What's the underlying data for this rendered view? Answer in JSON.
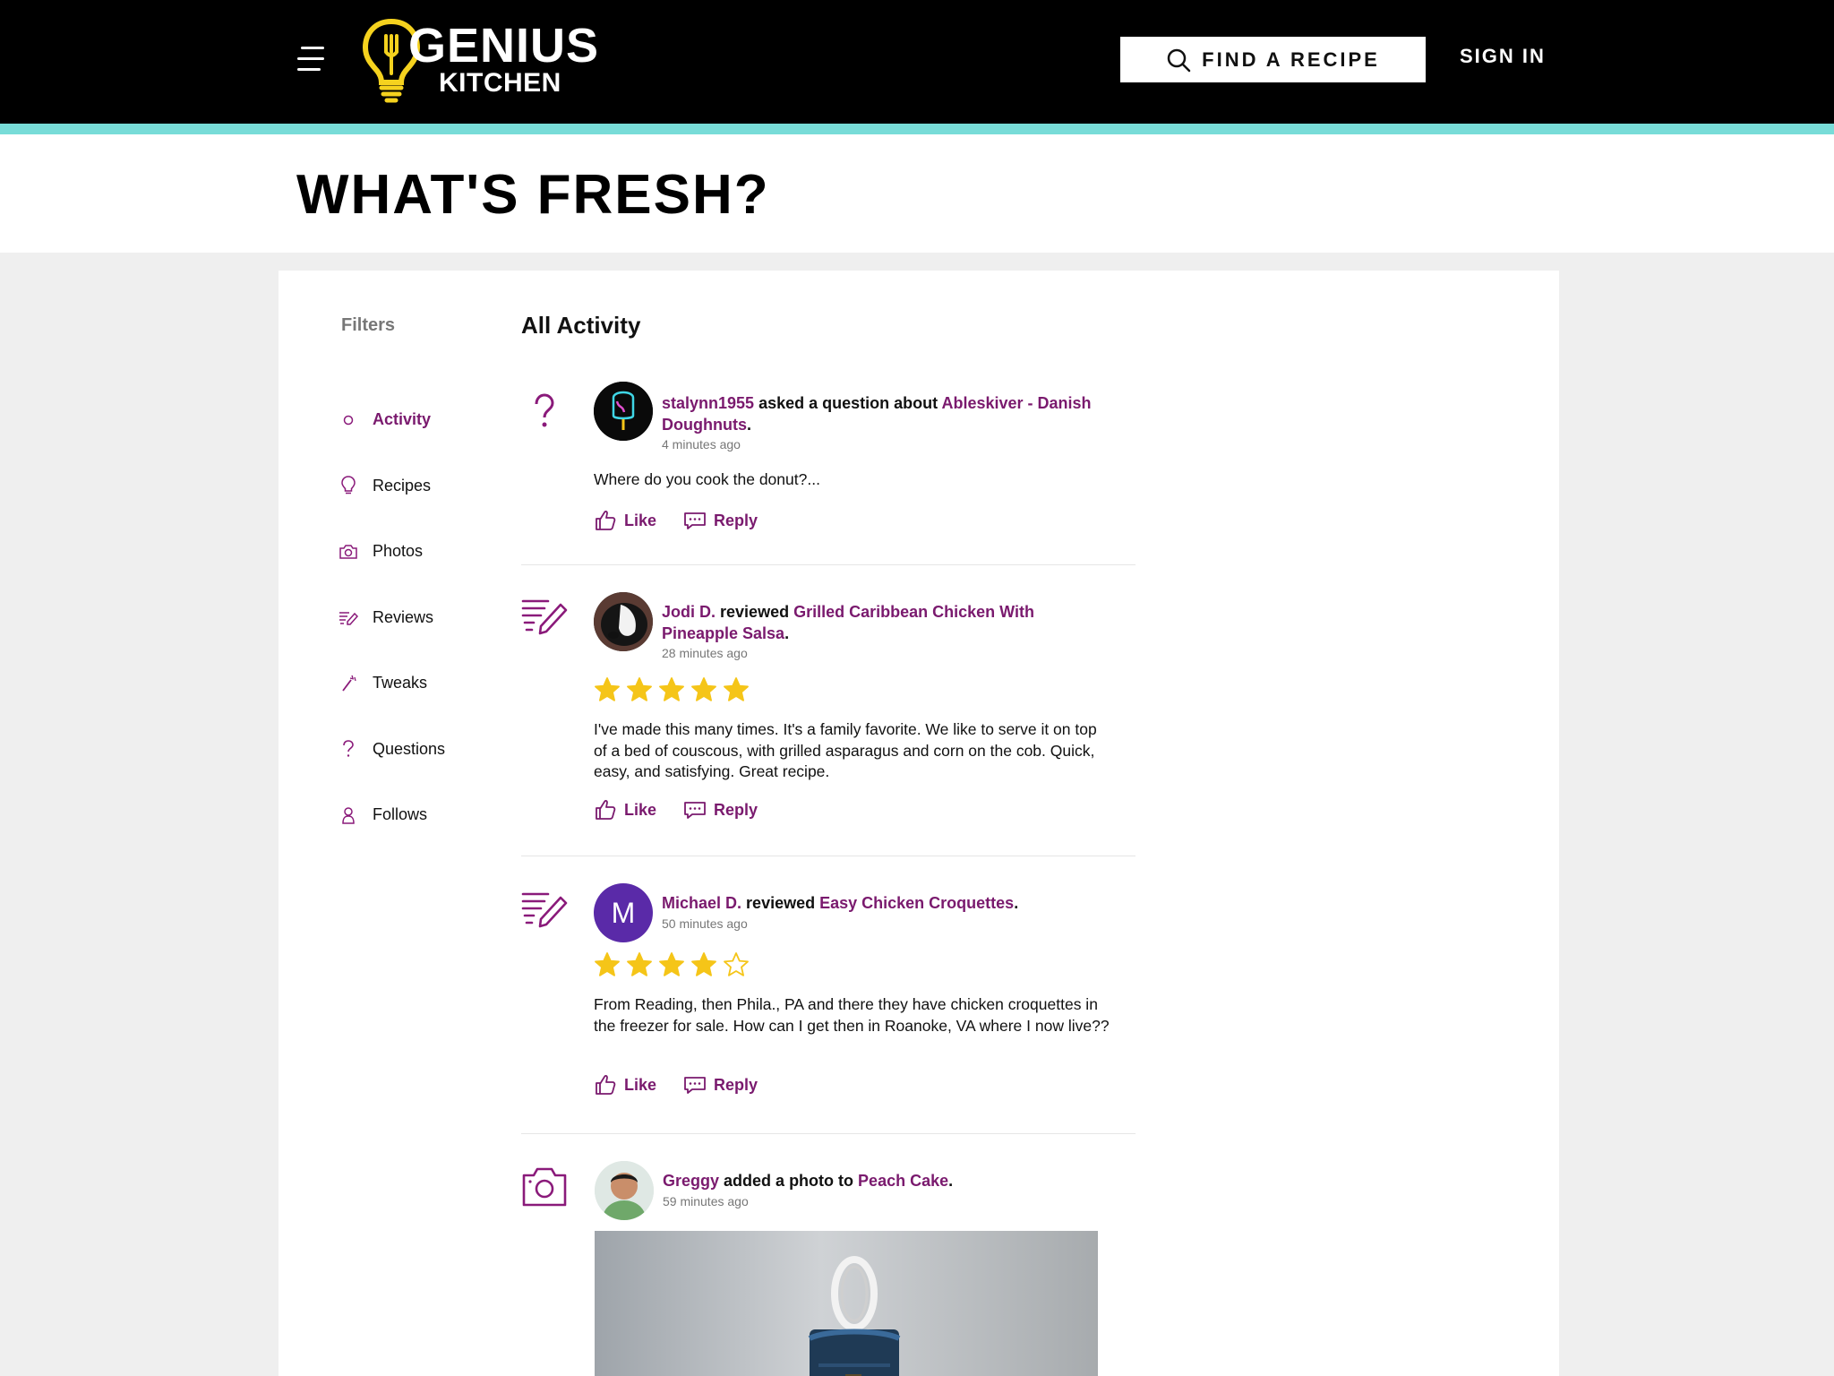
{
  "header": {
    "logo_word1": "GENIUS",
    "logo_word2": "KITCHEN",
    "find_recipe_label": "FIND A RECIPE",
    "sign_in_label": "SIGN IN",
    "accent_color": "#78dcd8",
    "logo_color": "#f5d21e"
  },
  "page": {
    "title": "WHAT'S FRESH?"
  },
  "filters": {
    "title": "Filters",
    "items": [
      {
        "label": "Activity",
        "icon": "circle-icon",
        "active": true
      },
      {
        "label": "Recipes",
        "icon": "lightbulb-icon"
      },
      {
        "label": "Photos",
        "icon": "camera-icon"
      },
      {
        "label": "Reviews",
        "icon": "review-pencil-icon"
      },
      {
        "label": "Tweaks",
        "icon": "wand-icon"
      },
      {
        "label": "Questions",
        "icon": "question-icon"
      },
      {
        "label": "Follows",
        "icon": "person-icon"
      }
    ]
  },
  "feed": {
    "title": "All Activity",
    "brand_purple": "#7a1a6e",
    "star_color": "#f5c518",
    "entries": [
      {
        "type": "question",
        "user": "stalynn1955",
        "verb": "asked a question about",
        "recipe": "Ableskiver - Danish Doughnuts",
        "time": "4 minutes ago",
        "body": "Where do you cook the donut?...",
        "like_label": "Like",
        "reply_label": "Reply"
      },
      {
        "type": "review",
        "user": "Jodi D.",
        "verb": "reviewed",
        "recipe": "Grilled Caribbean Chicken With Pineapple Salsa",
        "time": "28 minutes ago",
        "rating": 5,
        "body": "I've made this many times. It's a family favorite. We like to serve it on top of a bed of couscous, with grilled asparagus and corn on the cob. Quick, easy, and satisfying. Great recipe.",
        "like_label": "Like",
        "reply_label": "Reply"
      },
      {
        "type": "review",
        "user": "Michael D.",
        "avatar_letter": "M",
        "avatar_color": "#5a2aa8",
        "verb": "reviewed",
        "recipe": "Easy Chicken Croquettes",
        "time": "50 minutes ago",
        "rating": 4,
        "body": "From Reading, then Phila., PA and there they have chicken croquettes in the freezer for sale. How can I get then in Roanoke, VA where I now live??",
        "like_label": "Like",
        "reply_label": "Reply"
      },
      {
        "type": "photo",
        "user": "Greggy",
        "verb": "added a photo to",
        "recipe": "Peach Cake",
        "time": "59 minutes ago"
      }
    ]
  }
}
